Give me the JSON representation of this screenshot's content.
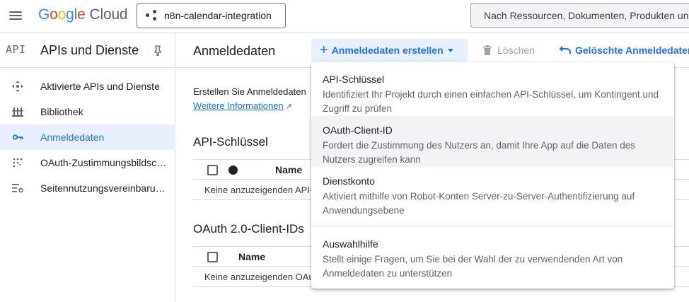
{
  "topbar": {
    "logo_google": [
      "G",
      "o",
      "o",
      "g",
      "l",
      "e"
    ],
    "logo_cloud": "Cloud",
    "project_name": "n8n-calendar-integration",
    "search_placeholder": "Nach Ressourcen, Dokumenten, Produkten und"
  },
  "sidebar": {
    "api_badge": "API",
    "title": "APIs und Dienste",
    "items": [
      {
        "label": "Aktivierte APIs und Dienste",
        "icon": "apis-icon",
        "active": false
      },
      {
        "label": "Bibliothek",
        "icon": "library-icon",
        "active": false
      },
      {
        "label": "Anmeldedaten",
        "icon": "key-icon",
        "active": true
      },
      {
        "label": "OAuth-Zustimmungsbildschirm",
        "icon": "consent-icon",
        "active": false
      },
      {
        "label": "Seitennutzungsvereinbarungen",
        "icon": "page-settings-icon",
        "active": false
      }
    ]
  },
  "main": {
    "title": "Anmeldedaten",
    "create_button": "Anmeldedaten erstellen",
    "delete_button": "Löschen",
    "restore_button": "Gelöschte Anmeldedaten",
    "intro": "Erstellen Sie Anmeldedaten",
    "more_info": "Weitere Informationen",
    "sections": [
      {
        "title": "API-Schlüssel",
        "column": "Name",
        "empty": "Keine anzuzeigenden API-Schlüssel"
      },
      {
        "title": "OAuth 2.0-Client-IDs",
        "column": "Name",
        "empty": "Keine anzuzeigenden OAuth-Clients"
      }
    ]
  },
  "menu": {
    "items": [
      {
        "title": "API-Schlüssel",
        "desc": "Identifiziert Ihr Projekt durch einen einfachen API-Schlüssel, um Kontingent und Zugriff zu prüfen"
      },
      {
        "title": "OAuth-Client-ID",
        "desc": "Fordert die Zustimmung des Nutzers an, damit Ihre App auf die Daten des Nutzers zugreifen kann"
      },
      {
        "title": "Dienstkonto",
        "desc": "Aktiviert mithilfe von Robot-Konten Server-zu-Server-Authentifizierung auf Anwendungsebene"
      },
      {
        "title": "Auswahlhilfe",
        "desc": "Stellt einige Fragen, um Sie bei der Wahl der zu verwendenden Art von Anmeldedaten zu unterstützen"
      }
    ]
  },
  "colors": {
    "accent": "#1a73e8",
    "active_bg": "#e8f0fe",
    "hover_bg": "#f1f3f4"
  }
}
